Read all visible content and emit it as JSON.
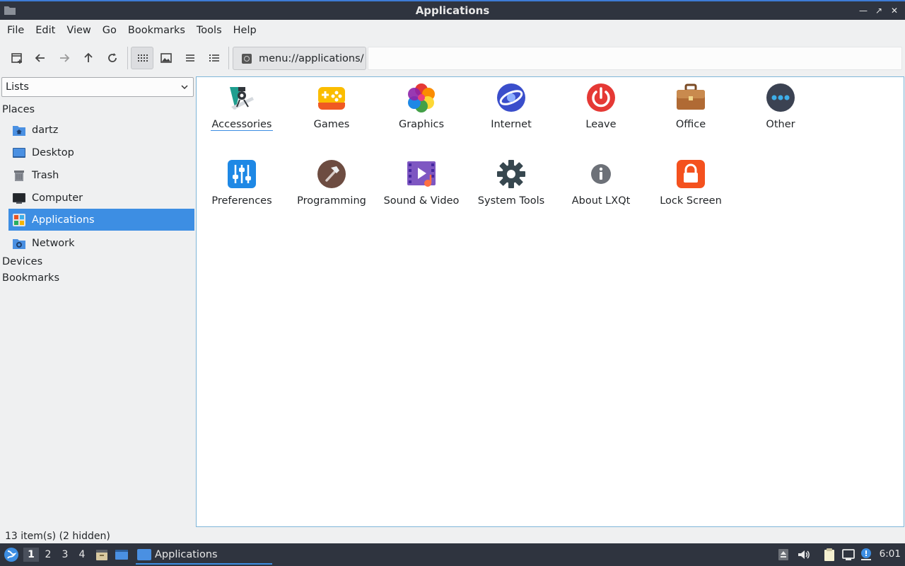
{
  "window": {
    "title": "Applications"
  },
  "menubar": {
    "items": [
      "File",
      "Edit",
      "View",
      "Go",
      "Bookmarks",
      "Tools",
      "Help"
    ]
  },
  "toolbar": {
    "path": "menu://applications/"
  },
  "sidepane": {
    "selector": "Lists",
    "sections": {
      "places": "Places",
      "devices": "Devices",
      "bookmarks": "Bookmarks"
    },
    "places": [
      {
        "label": "dartz",
        "icon": "home-folder-icon"
      },
      {
        "label": "Desktop",
        "icon": "desktop-icon"
      },
      {
        "label": "Trash",
        "icon": "trash-icon"
      },
      {
        "label": "Computer",
        "icon": "computer-icon"
      },
      {
        "label": "Applications",
        "icon": "applications-icon",
        "selected": true
      },
      {
        "label": "Network",
        "icon": "network-folder-icon"
      }
    ]
  },
  "apps": [
    {
      "label": "Accessories",
      "icon": "accessories-icon"
    },
    {
      "label": "Games",
      "icon": "gamepad-icon"
    },
    {
      "label": "Graphics",
      "icon": "graphics-petals-icon"
    },
    {
      "label": "Internet",
      "icon": "internet-globe-icon"
    },
    {
      "label": "Leave",
      "icon": "power-icon"
    },
    {
      "label": "Office",
      "icon": "briefcase-icon"
    },
    {
      "label": "Other",
      "icon": "more-dots-icon"
    },
    {
      "label": "Preferences",
      "icon": "sliders-icon"
    },
    {
      "label": "Programming",
      "icon": "hammer-icon"
    },
    {
      "label": "Sound & Video",
      "icon": "multimedia-icon"
    },
    {
      "label": "System Tools",
      "icon": "gear-icon"
    },
    {
      "label": "About LXQt",
      "icon": "info-icon"
    },
    {
      "label": "Lock Screen",
      "icon": "lock-icon"
    }
  ],
  "statusbar": {
    "text": "13 item(s) (2 hidden)"
  },
  "taskbar": {
    "desktops": [
      "1",
      "2",
      "3",
      "4"
    ],
    "active_window": "Applications",
    "clock": "6:01"
  },
  "colors": {
    "accent": "#3d8ee3",
    "titlebar": "#2f343f",
    "window_bg": "#eff0f1"
  }
}
